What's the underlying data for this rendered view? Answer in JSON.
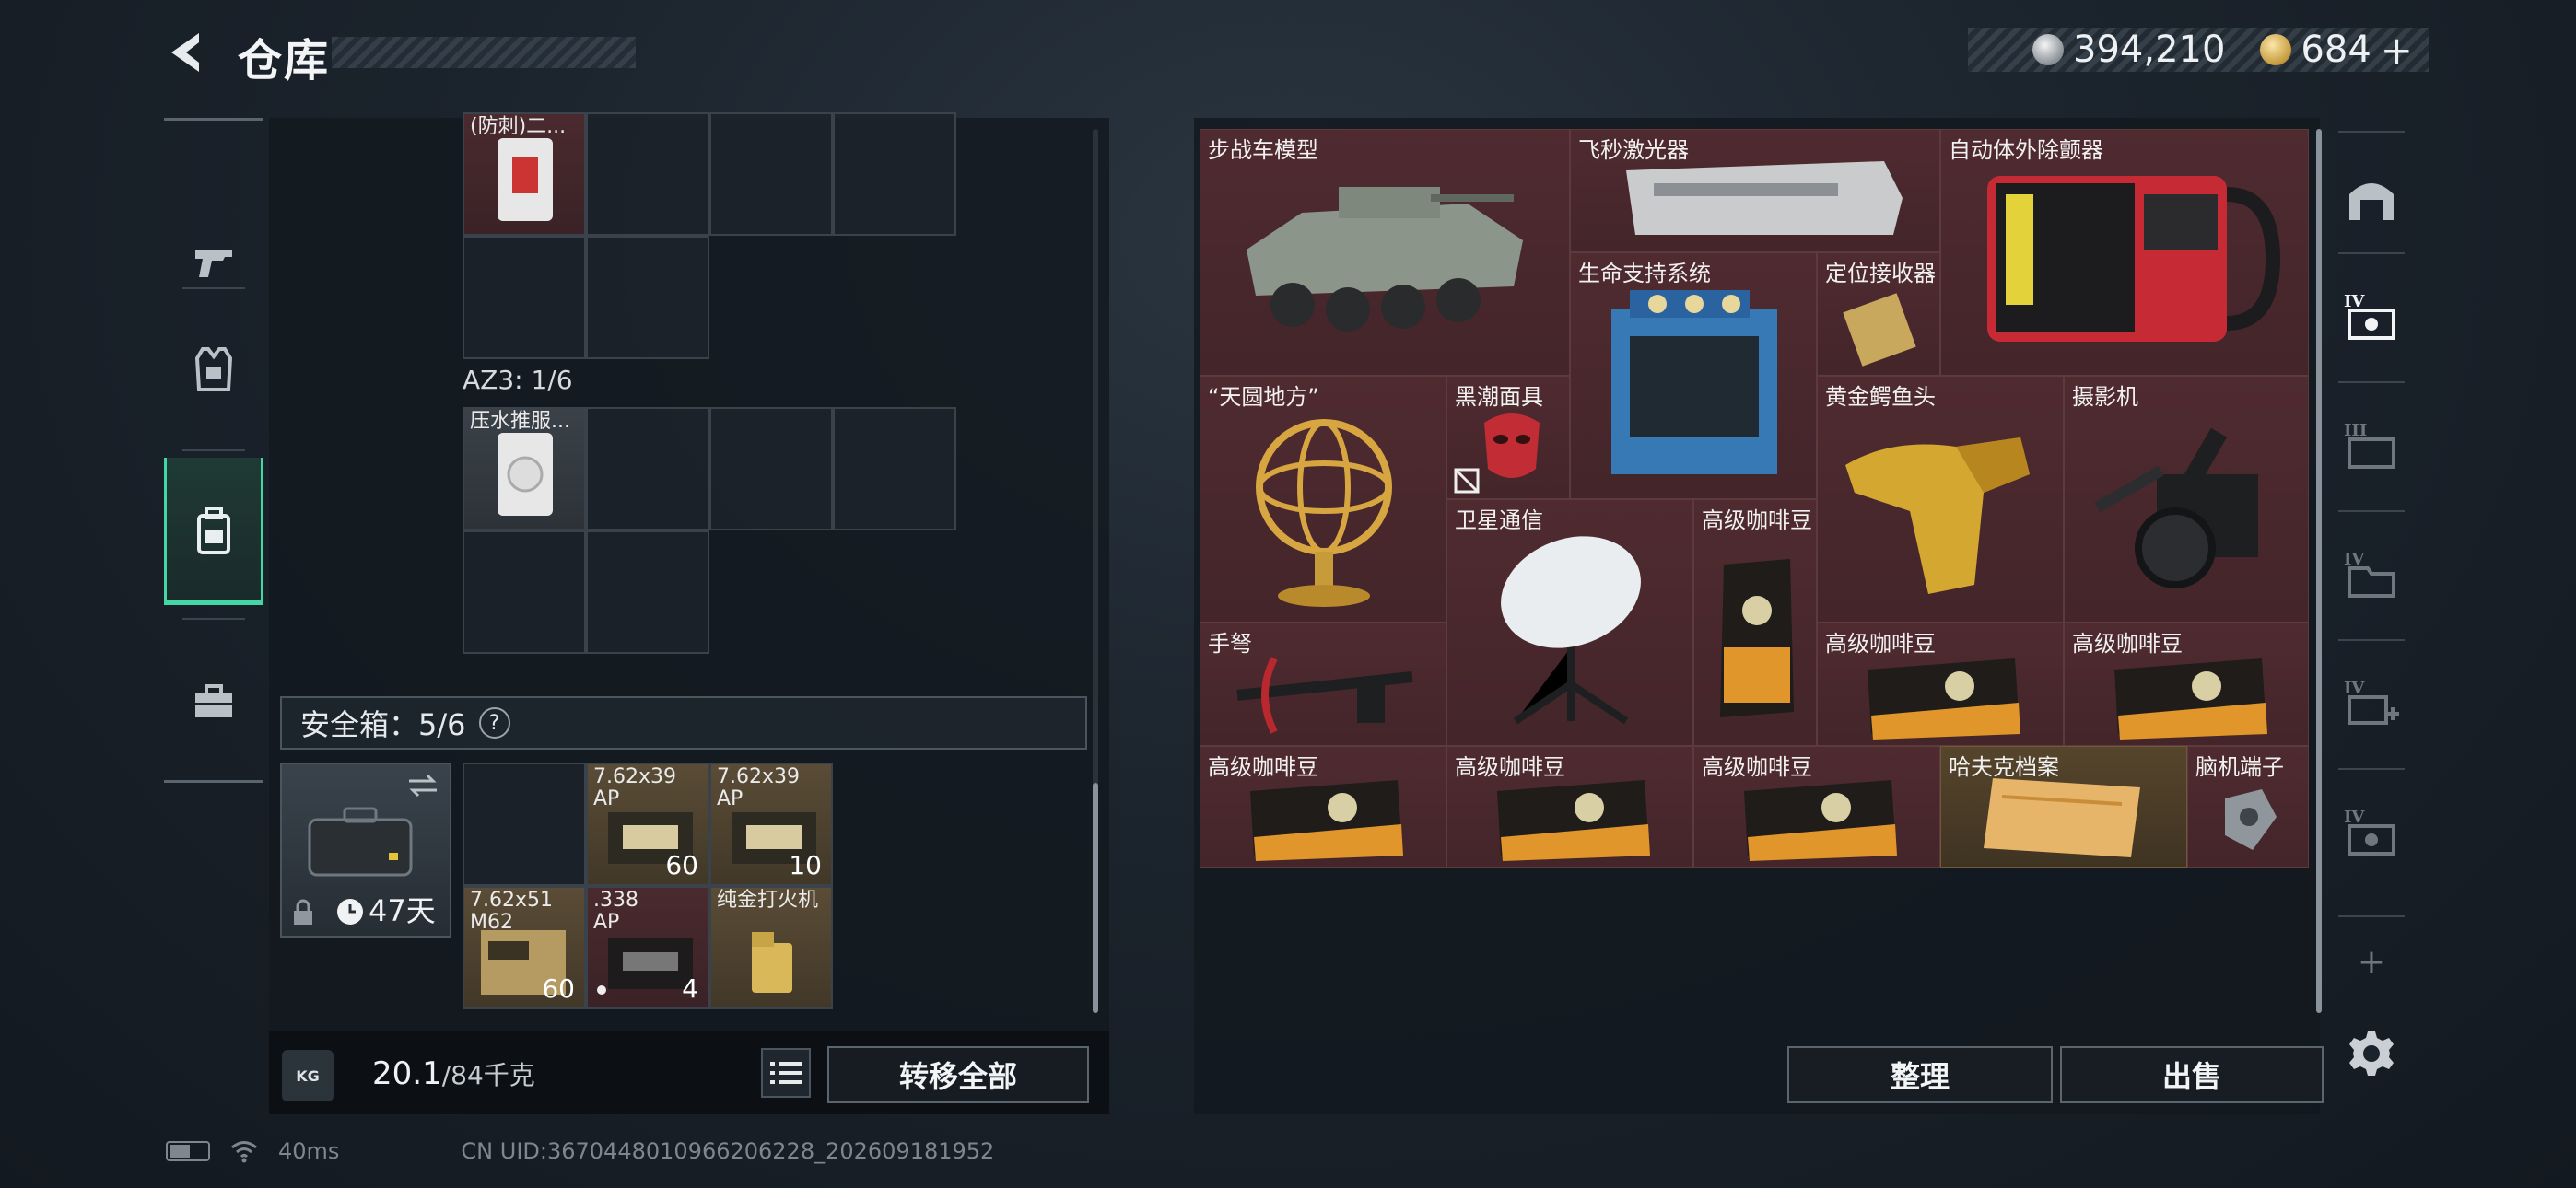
{
  "header": {
    "title": "仓库",
    "currency": [
      {
        "icon": "silver-coin-icon",
        "value": "394,210"
      },
      {
        "icon": "gold-coin-icon",
        "value": "684"
      }
    ],
    "add_label": "+"
  },
  "left_rail": {
    "items": [
      {
        "name": "weapons",
        "icon": "pistol-icon"
      },
      {
        "name": "armor",
        "icon": "vest-icon"
      },
      {
        "name": "backpack",
        "icon": "backpack-icon",
        "active": true
      },
      {
        "name": "toolbox",
        "icon": "toolbox-icon"
      }
    ]
  },
  "container_top": {
    "items": [
      {
        "label": "(防刺)二..."
      }
    ]
  },
  "az3": {
    "label": "AZ3: 1/6",
    "items": [
      {
        "label": "压水推服..."
      }
    ]
  },
  "safe_box": {
    "label": "安全箱：5/6",
    "help": "?",
    "expires": "47天",
    "items": [
      {
        "label": "7.62x39\nAP",
        "count": "60"
      },
      {
        "label": "7.62x39\nAP",
        "count": "10"
      },
      {
        "label": "7.62x51\nM62",
        "count": "60"
      },
      {
        "label": ".338\nAP",
        "count": "4"
      },
      {
        "label": "纯金打火机",
        "count": ""
      }
    ]
  },
  "weight": {
    "current": "20.1",
    "max": "/84千克",
    "kg_icon_label": "KG"
  },
  "buttons": {
    "transfer_all": "转移全部",
    "organize": "整理",
    "sell": "出售"
  },
  "stash_items": [
    {
      "id": "ifv",
      "label": "步战车模型"
    },
    {
      "id": "laser",
      "label": "飞秒激光器"
    },
    {
      "id": "aed",
      "label": "自动体外除颤器"
    },
    {
      "id": "life",
      "label": "生命支持系统"
    },
    {
      "id": "locator",
      "label": "定位接收器"
    },
    {
      "id": "armillary",
      "label": "“天圆地方”"
    },
    {
      "id": "mask",
      "label": "黑潮面具"
    },
    {
      "id": "croc",
      "label": "黄金鳄鱼头"
    },
    {
      "id": "camera",
      "label": "摄影机"
    },
    {
      "id": "satcom",
      "label": "卫星通信"
    },
    {
      "id": "coffee1",
      "label": "高级咖啡豆"
    },
    {
      "id": "crossbow",
      "label": "手弩"
    },
    {
      "id": "coffee2",
      "label": "高级咖啡豆"
    },
    {
      "id": "coffee3",
      "label": "高级咖啡豆"
    },
    {
      "id": "coffee4",
      "label": "高级咖啡豆"
    },
    {
      "id": "coffee5",
      "label": "高级咖啡豆"
    },
    {
      "id": "coffee6",
      "label": "高级咖啡豆"
    },
    {
      "id": "hafk",
      "label": "哈夫克档案"
    },
    {
      "id": "brain",
      "label": "脑机端子"
    }
  ],
  "right_rail": {
    "items": [
      {
        "name": "shelter",
        "icon": "shelter-icon"
      },
      {
        "name": "tab-iv-1",
        "icon": "storage-iv-icon",
        "active": true
      },
      {
        "name": "tab-iii",
        "icon": "storage-iii-icon"
      },
      {
        "name": "tab-iv-2",
        "icon": "folder-iv-icon"
      },
      {
        "name": "tab-iv-3",
        "icon": "medical-iv-icon"
      },
      {
        "name": "tab-iv-4",
        "icon": "storage-iv-icon-2"
      }
    ],
    "add_label": "+"
  },
  "status_bar": {
    "ping": "40ms",
    "uid": "CN UID:3670448010966206228_202609181952"
  }
}
